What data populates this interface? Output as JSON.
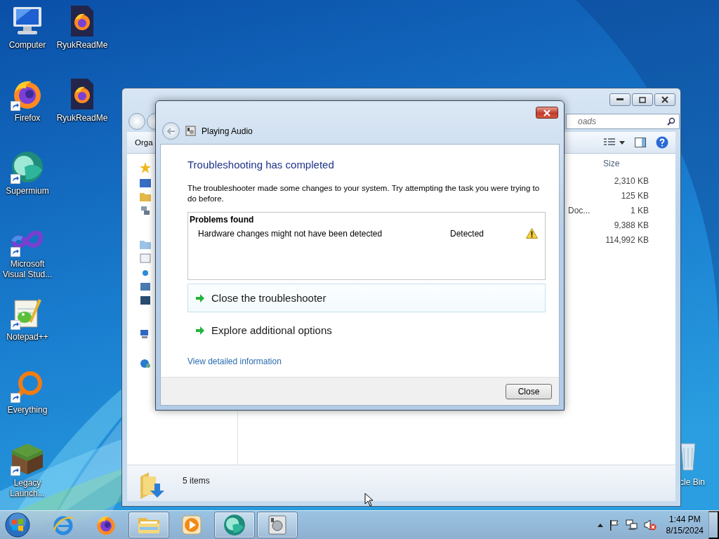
{
  "desktop_icons": [
    {
      "label": "Computer",
      "kind": "computer",
      "shortcut": false
    },
    {
      "label": "Firefox",
      "kind": "firefox",
      "shortcut": true
    },
    {
      "label": "Supermium",
      "kind": "supermium",
      "shortcut": true
    },
    {
      "label": "Microsoft Visual Stud...",
      "kind": "visual-studio",
      "shortcut": true
    },
    {
      "label": "Notepad++",
      "kind": "notepad",
      "shortcut": true
    },
    {
      "label": "Everything",
      "kind": "everything",
      "shortcut": true
    },
    {
      "label": "Legacy Launch...",
      "kind": "minecraft",
      "shortcut": true
    },
    {
      "label": "RyukReadMe",
      "kind": "firefox-document",
      "shortcut": false
    },
    {
      "label": "RyukReadMe",
      "kind": "firefox-document",
      "shortcut": false
    }
  ],
  "recycle_bin": {
    "label": "cle Bin"
  },
  "explorer": {
    "search": {
      "placeholder": "oads"
    },
    "toolbar": {
      "organize": "Orga"
    },
    "column": "Size",
    "rows": [
      {
        "size": "2,310 KB"
      },
      {
        "size": "125 KB"
      },
      {
        "name": "Doc...",
        "size": "1 KB"
      },
      {
        "size": "9,388 KB"
      },
      {
        "size": "114,992 KB"
      }
    ],
    "status": "5 items"
  },
  "dialog": {
    "title": "Playing Audio",
    "heading": "Troubleshooting has completed",
    "message": "The troubleshooter made some changes to your system. Try attempting the task you were trying to do before.",
    "problems": {
      "title": "Problems found",
      "items": [
        {
          "text": "Hardware changes might not have been detected",
          "status": "Detected"
        }
      ]
    },
    "options": [
      {
        "label": "Close the troubleshooter",
        "highlighted": true
      },
      {
        "label": "Explore additional options",
        "highlighted": false
      }
    ],
    "link": "View detailed information",
    "button": "Close"
  },
  "taskbar": {
    "items": [
      {
        "kind": "internet-explorer",
        "running": false
      },
      {
        "kind": "firefox",
        "running": false
      },
      {
        "kind": "explorer",
        "running": true
      },
      {
        "kind": "media-player",
        "running": false
      },
      {
        "kind": "supermium",
        "running": true
      },
      {
        "kind": "troubleshooter",
        "running": true
      }
    ],
    "clock": {
      "time": "1:44 PM",
      "date": "8/15/2024"
    }
  }
}
